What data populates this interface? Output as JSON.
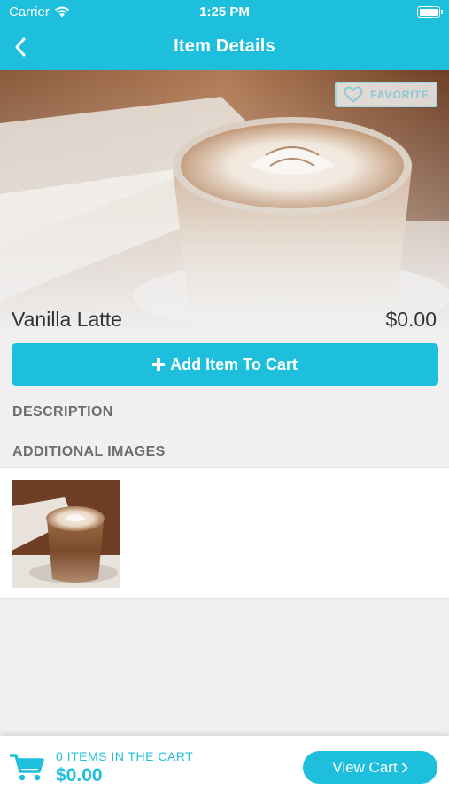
{
  "status_bar": {
    "carrier": "Carrier",
    "time": "1:25 PM",
    "battery_level": 1.0
  },
  "nav": {
    "title": "Item Details",
    "back_icon": "chevron-left-icon"
  },
  "item": {
    "name": "Vanilla Latte",
    "price": "$0.00",
    "favorite_label": "FAVORITE",
    "favorite_icon": "heart-icon"
  },
  "actions": {
    "add_to_cart_label": "Add Item To Cart",
    "add_icon": "plus-icon"
  },
  "sections": {
    "description_label": "DESCRIPTION",
    "additional_images_label": "ADDITIONAL IMAGES"
  },
  "cart": {
    "items_count_label": "0 ITEMS IN THE CART",
    "total": "$0.00",
    "view_cart_label": "View Cart",
    "cart_icon": "shopping-cart-icon",
    "view_cart_icon": "chevron-right-icon"
  },
  "colors": {
    "accent": "#1ebfdc",
    "background": "#f0f0f0"
  }
}
